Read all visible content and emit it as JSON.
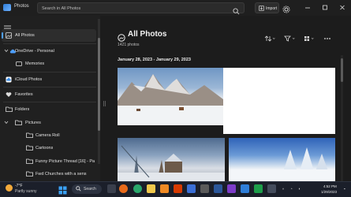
{
  "window": {
    "app_title": "Photos"
  },
  "search": {
    "placeholder": "Search in All Photos"
  },
  "toolbar": {
    "import_label": "Import"
  },
  "sidebar": {
    "items": [
      {
        "label": "All Photos"
      },
      {
        "label": "OneDrive - Personal"
      },
      {
        "label": "Memories"
      },
      {
        "label": "iCloud Photos"
      },
      {
        "label": "Favorites"
      },
      {
        "label": "Folders"
      },
      {
        "label": "Pictures"
      },
      {
        "label": "Camera Roll"
      },
      {
        "label": "Cartoons"
      },
      {
        "label": "Funny Picture Thread [16] - Pa"
      },
      {
        "label": "Fwd Churches with a sens"
      }
    ]
  },
  "main": {
    "title": "All Photos",
    "count": "1421 photos",
    "date_range": "January 28, 2023 - January 29, 2023"
  },
  "taskbar": {
    "weather_temp": "-7°F",
    "weather_desc": "Partly sunny",
    "search_label": "Search",
    "time": "4:52 PM",
    "date": "1/29/2023"
  },
  "colors": {
    "accent": "#4ea0ff",
    "background": "#1c1c1c",
    "sidebar": "#202020"
  }
}
